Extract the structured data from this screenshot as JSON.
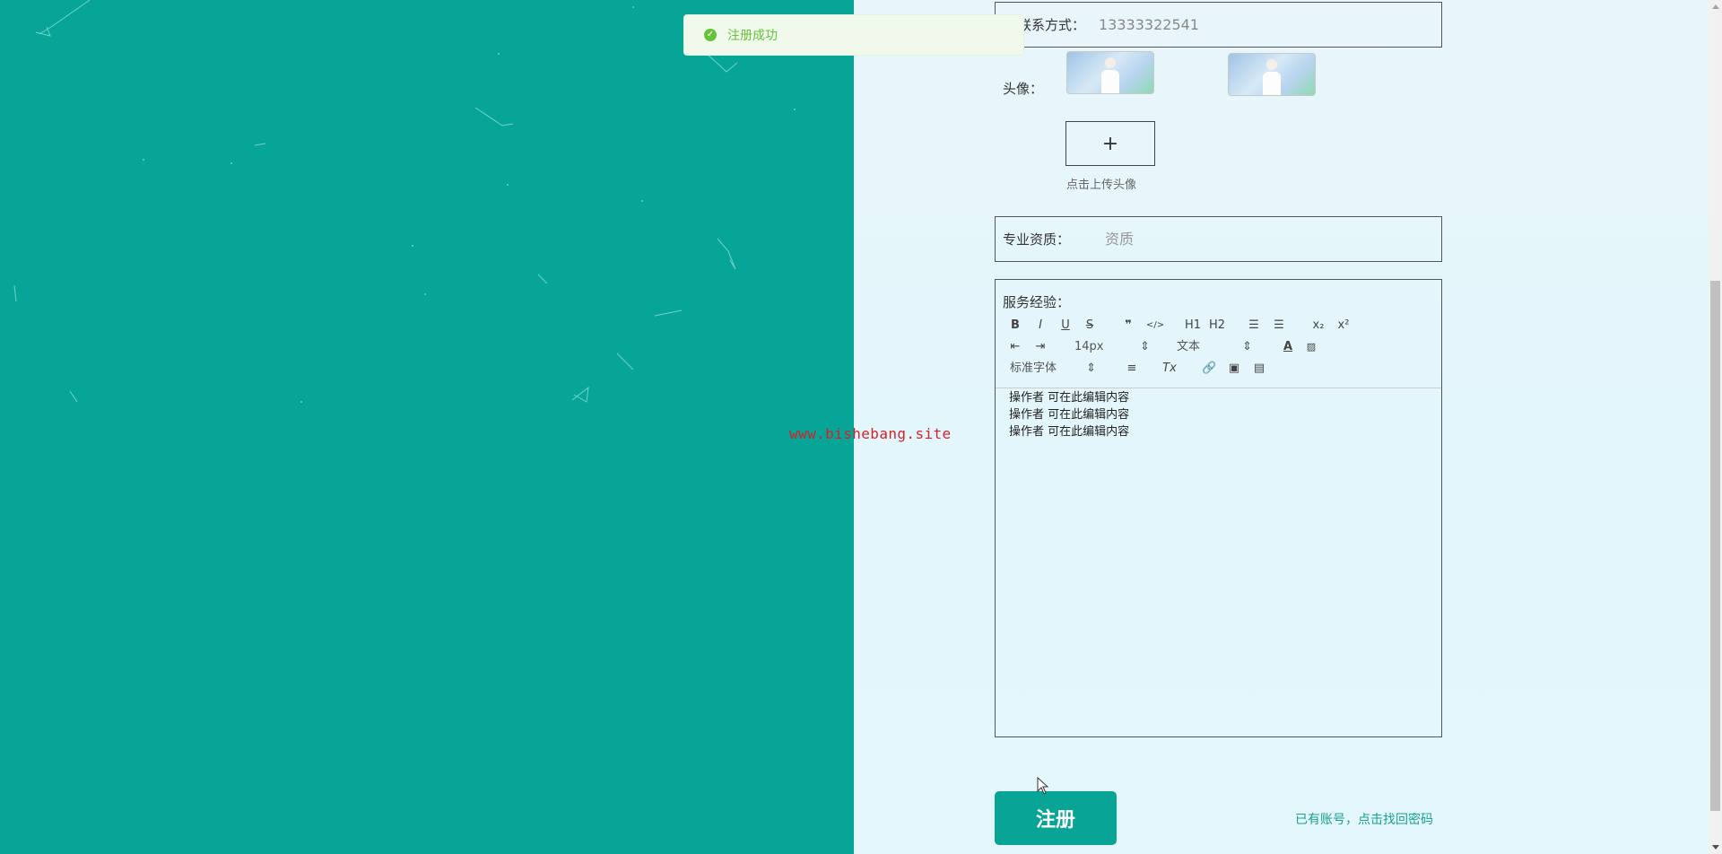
{
  "toast": {
    "message": "注册成功",
    "icon": "check-circle-icon",
    "color": "#67c23a"
  },
  "watermark": "www.bishebang.site",
  "form": {
    "contact": {
      "label": "联系方式：",
      "value": "13333322541"
    },
    "avatar": {
      "label": "头像：",
      "upload_hint": "点击上传头像",
      "upload_symbol": "+"
    },
    "qualification": {
      "label": "专业资质：",
      "placeholder": "资质"
    },
    "experience": {
      "label": "服务经验：",
      "toolbar": {
        "buttons": [
          "B",
          "I",
          "U",
          "S",
          "❞",
          "</>",
          "H1",
          "H2",
          "ol",
          "ul",
          "x₂",
          "x²",
          "outdent",
          "indent",
          "A",
          "bg",
          "align",
          "Tx",
          "link",
          "image",
          "video"
        ],
        "font_size": "14px",
        "header": "文本",
        "font_family": "标准字体"
      },
      "content_lines": [
        "操作者  可在此编辑内容",
        "操作者  可在此编辑内容",
        "操作者  可在此编辑内容"
      ]
    }
  },
  "actions": {
    "submit_label": "注册",
    "login_link": "已有账号，点击找回密码"
  },
  "colors": {
    "primary": "#08a597",
    "left_background": "#07a597"
  }
}
